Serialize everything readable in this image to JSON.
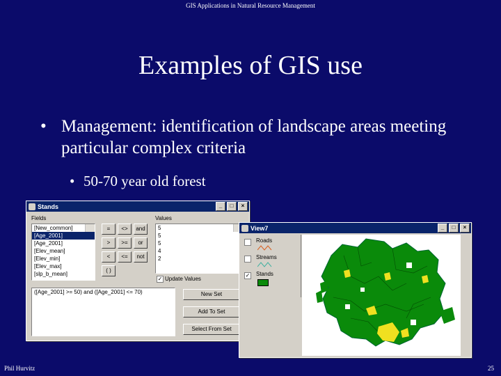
{
  "header": "GIS Applications in Natural Resource Management",
  "title": "Examples of GIS use",
  "bullet1": "Management: identification of landscape areas meeting particular complex criteria",
  "bullet2": "50-70 year old forest",
  "bullet_char": "•",
  "footer_left": "Phil Hurvitz",
  "footer_right": "25",
  "query_window": {
    "title": "Stands",
    "fields_label": "Fields",
    "fields": [
      "[New_common]",
      "[Age_2001]",
      "[Age_2001]",
      "[Elev_mean]",
      "[Elev_min]",
      "[Elev_max]",
      "[slp_b_mean]"
    ],
    "operators": [
      [
        "=",
        "<>",
        "and"
      ],
      [
        ">",
        ">=",
        "or"
      ],
      [
        "<",
        "<=",
        "not"
      ],
      [
        "( )"
      ]
    ],
    "values_label": "Values",
    "values": [
      "5",
      "5",
      "5",
      "4",
      "2"
    ],
    "update_values_label": "Update Values",
    "expression": "([Age_2001] >= 50) and ([Age_2001] <= 70)",
    "buttons": [
      "New Set",
      "Add To Set",
      "Select From Set"
    ]
  },
  "view_window": {
    "title": "View7",
    "layers": [
      {
        "name": "Roads",
        "checked": false,
        "color": "#d86020"
      },
      {
        "name": "Streams",
        "checked": false,
        "color": "#40b0a0"
      },
      {
        "name": "Stands",
        "checked": true,
        "color": "#0a8a0a"
      }
    ]
  },
  "colors": {
    "background": "#0b0b6a",
    "forest": "#0a8a0a",
    "selection": "#f0e020"
  }
}
